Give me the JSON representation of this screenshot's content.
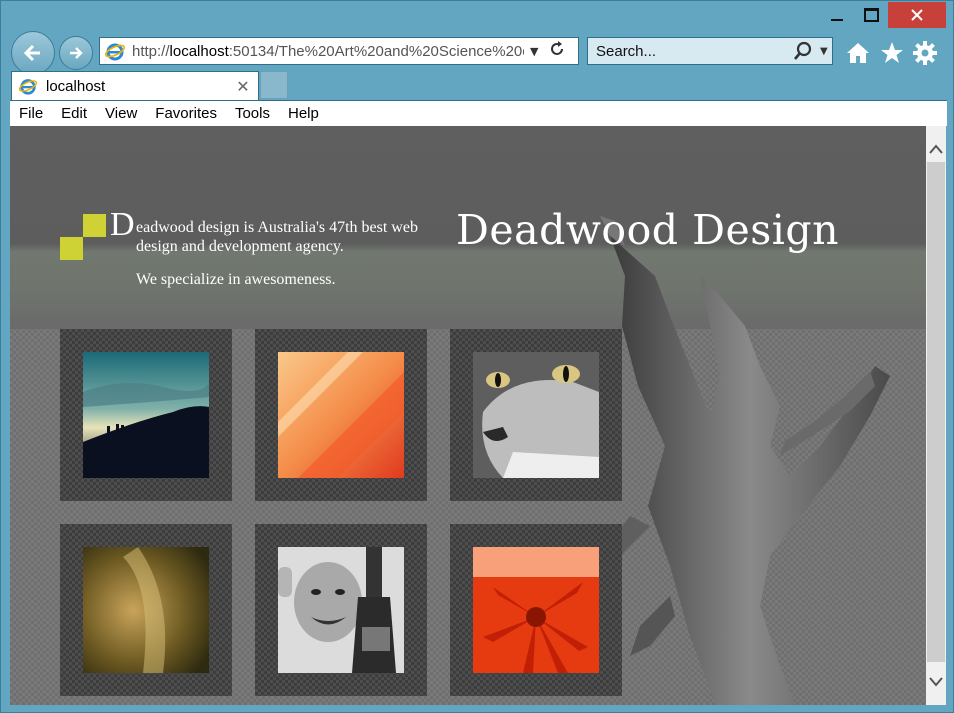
{
  "window": {
    "controls": {
      "minimize": "minimize",
      "maximize": "maximize",
      "close": "close"
    }
  },
  "address_bar": {
    "url_prefix": "http://",
    "url_host": "localhost",
    "url_rest": ":50134/The%20Art%20and%20Science%20o"
  },
  "search": {
    "placeholder": "Search..."
  },
  "tab": {
    "title": "localhost"
  },
  "menu": [
    "File",
    "Edit",
    "View",
    "Favorites",
    "Tools",
    "Help"
  ],
  "page": {
    "brand": "Deadwood Design",
    "dropcap": "D",
    "tagline_rest": "eadwood design is Australia's 47th best web design and development agency.",
    "tagline_2": "We specialize in awesomeness."
  },
  "gallery": [
    {
      "subject": "silhouettes on hill at dusk"
    },
    {
      "subject": "orange fabric texture"
    },
    {
      "subject": "cat face close-up"
    },
    {
      "subject": "golden blurred texture"
    },
    {
      "subject": "man with bottle"
    },
    {
      "subject": "red flower"
    }
  ],
  "colors": {
    "frame": "#62a6c1",
    "close_button": "#c7403a",
    "logo_accent": "#cfd234"
  }
}
